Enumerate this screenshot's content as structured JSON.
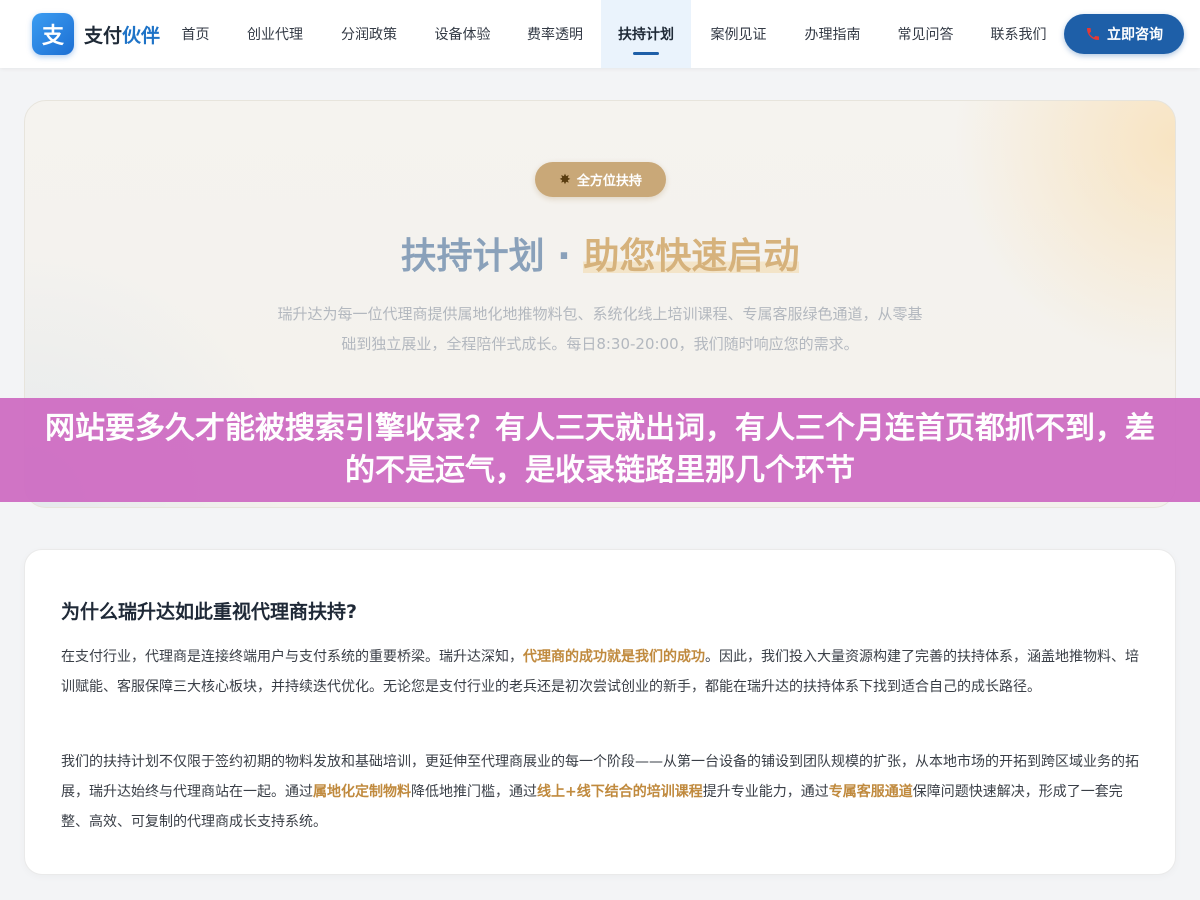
{
  "header": {
    "logo_icon_char": "支",
    "logo_text_main": "支付",
    "logo_text_accent": "伙伴",
    "nav": [
      {
        "label": "首页"
      },
      {
        "label": "创业代理"
      },
      {
        "label": "分润政策"
      },
      {
        "label": "设备体验"
      },
      {
        "label": "费率透明"
      },
      {
        "label": "扶持计划",
        "active": true
      },
      {
        "label": "案例见证"
      },
      {
        "label": "办理指南"
      },
      {
        "label": "常见问答"
      },
      {
        "label": "联系我们"
      }
    ],
    "cta_label": "立即咨询",
    "cta_icon": "phone-icon"
  },
  "hero": {
    "badge_icon": "star-burst-icon",
    "badge_label": "全方位扶持",
    "title_part1": "扶持计划 · ",
    "title_part2": "助您快速启动",
    "description": "瑞升达为每一位代理商提供属地化地推物料包、系统化线上培训课程、专属客服绿色通道，从零基础到独立展业，全程陪伴式成长。每日8:30-20:00，我们随时响应您的需求。"
  },
  "banner": {
    "text": "网站要多久才能被搜索引擎收录？有人三天就出词，有人三个月连首页都抓不到，差的不是运气，是收录链路里那几个环节"
  },
  "section": {
    "title": "为什么瑞升达如此重视代理商扶持?",
    "p1": {
      "t1": "在支付行业，代理商是连接终端用户与支付系统的重要桥梁。瑞升达深知，",
      "h1": "代理商的成功就是我们的成功",
      "t2": "。因此，我们投入大量资源构建了完善的扶持体系，涵盖地推物料、培训赋能、客服保障三大核心板块，并持续迭代优化。无论您是支付行业的老兵还是初次尝试创业的新手，都能在瑞升达的扶持体系下找到适合自己的成长路径。"
    },
    "p2": {
      "t1": "我们的扶持计划不仅限于签约初期的物料发放和基础培训，更延伸至代理商展业的每一个阶段——从第一台设备的铺设到团队规模的扩张，从本地市场的开拓到跨区域业务的拓展，瑞升达始终与代理商站在一起。通过",
      "h1": "属地化定制物料",
      "t2": "降低地推门槛，通过",
      "h2": "线上+线下结合的培训课程",
      "t3": "提升专业能力，通过",
      "h3": "专属客服通道",
      "t4": "保障问题快速解决，形成了一套完整、高效、可复制的代理商成长支持系统。"
    }
  },
  "colors": {
    "brand_blue": "#1e5fa8",
    "nav_active_bg": "#eaf3fc",
    "badge_gold": "#c9a878",
    "highlight_gold": "#c08a3e",
    "banner_magenta": "#cf6fc4"
  }
}
